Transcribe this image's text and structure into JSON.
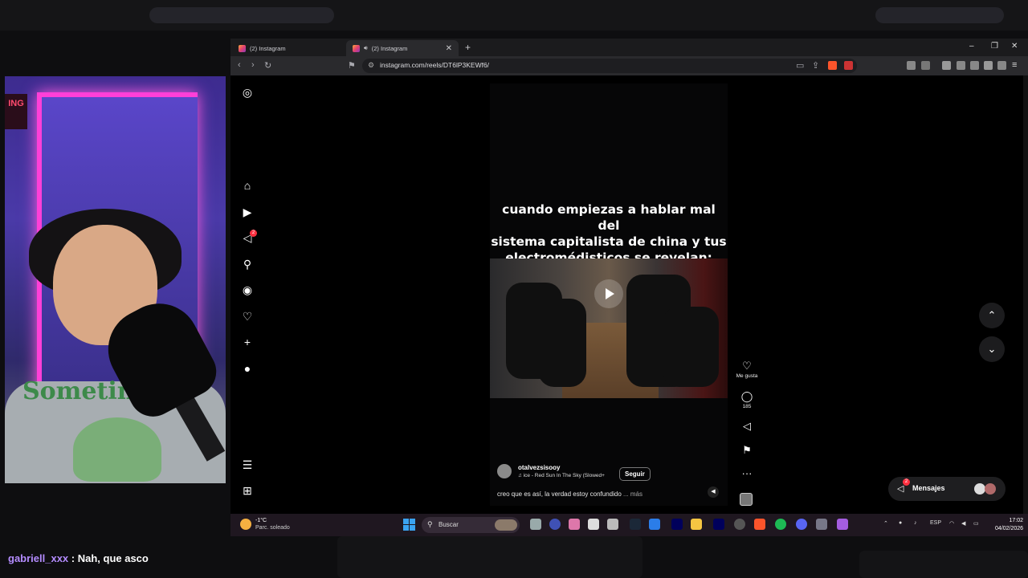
{
  "chat": {
    "username": "gabriell_xxx",
    "separator": " : ",
    "message": "Nah, que asco"
  },
  "webcam": {
    "shirt_text": "Sometin",
    "neon_sign": "ING"
  },
  "browser": {
    "tabs": [
      {
        "label": "(2) Instagram"
      },
      {
        "label": "(2) Instagram",
        "audio_icon": "speaker-icon"
      }
    ],
    "new_tab": "+",
    "window_controls": {
      "minimize": "–",
      "restore": "❐",
      "close": "✕"
    },
    "url": "instagram.com/reels/DT6lP3KEWf6/"
  },
  "instagram": {
    "nav_icons": [
      "instagram-logo-icon",
      "home-icon",
      "reels-icon",
      "direct-icon",
      "search-icon",
      "explore-icon",
      "heart-icon",
      "create-icon",
      "profile-icon",
      "menu-icon",
      "more-apps-icon"
    ],
    "direct_badge": "2",
    "reel": {
      "overlay_line1": "cuando empiezas a hablar mal del",
      "overlay_line2": "sistema capitalista de china y tus",
      "overlay_line3": "electromédisticos se revelan:",
      "author": "otalvezsisooy",
      "song": "ice - Red Sun In The Sky (Slowed+",
      "follow": "Seguir",
      "description": "creo que es así, la verdad estoy confundido",
      "more": "... más"
    },
    "actions": {
      "like_label": "Me gusta",
      "comments_count": "185"
    },
    "messages": {
      "label": "Mensajes",
      "badge": "2"
    }
  },
  "taskbar": {
    "weather_temp": "-1°C",
    "weather_desc": "Parc. soleado",
    "search_label": "Buscar",
    "language": "ESP",
    "time": "17:02",
    "date": "04/02/2026"
  },
  "colors": {
    "chat_username": "#b48cff",
    "notification_red": "#ff3040",
    "neon_pink": "#ff3fd8"
  }
}
